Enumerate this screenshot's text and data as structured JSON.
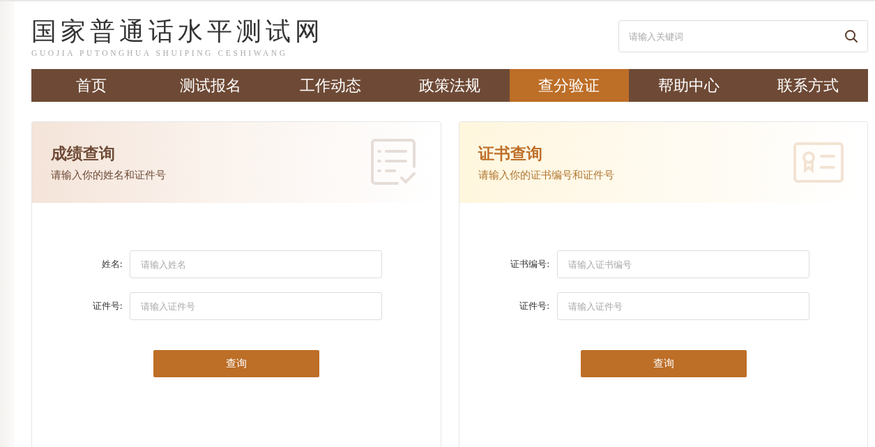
{
  "logo": {
    "title": "国家普通话水平测试网",
    "subtitle": "GUOJIA PUTONGHUA SHUIPING CESHIWANG"
  },
  "search": {
    "placeholder": "请输入关键词"
  },
  "nav": [
    {
      "label": "首页",
      "selected": false
    },
    {
      "label": "测试报名",
      "selected": false
    },
    {
      "label": "工作动态",
      "selected": false
    },
    {
      "label": "政策法规",
      "selected": false
    },
    {
      "label": "查分验证",
      "selected": true
    },
    {
      "label": "帮助中心",
      "selected": false
    },
    {
      "label": "联系方式",
      "selected": false
    }
  ],
  "cards": [
    {
      "kind": "score",
      "title": "成绩查询",
      "subtitle": "请输入你的姓名和证件号",
      "fields": [
        {
          "label": "姓名:",
          "placeholder": "请输入姓名"
        },
        {
          "label": "证件号:",
          "placeholder": "请输入证件号"
        }
      ],
      "button": "查询"
    },
    {
      "kind": "certificate",
      "title": "证书查询",
      "subtitle": "请输入你的证书编号和证件号",
      "fields": [
        {
          "label": "证书编号:",
          "placeholder": "请输入证书编号"
        },
        {
          "label": "证件号:",
          "placeholder": "请输入证件号"
        }
      ],
      "button": "查询"
    }
  ]
}
